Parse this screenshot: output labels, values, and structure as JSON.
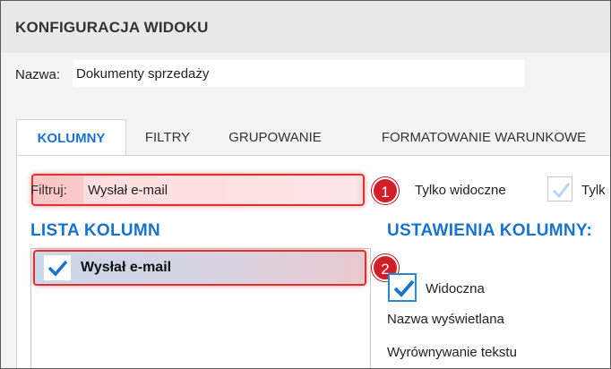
{
  "window": {
    "title": "KONFIGURACJA WIDOKU"
  },
  "name_field": {
    "label": "Nazwa:",
    "value": "Dokumenty sprzedaży"
  },
  "tabs": [
    {
      "label": "KOLUMNY",
      "active": true
    },
    {
      "label": "FILTRY",
      "active": false
    },
    {
      "label": "GRUPOWANIE",
      "active": false
    },
    {
      "label": "FORMATOWANIE WARUNKOWE",
      "active": false
    }
  ],
  "filter": {
    "label": "Filtruj:",
    "value": "Wysłał e-mail"
  },
  "options": {
    "only_visible_label": "Tylko widoczne",
    "truncated_label": "Tylk"
  },
  "callouts": {
    "one": "1",
    "two": "2"
  },
  "columns_list": {
    "header": "LISTA KOLUMN",
    "items": [
      {
        "label": "Wysłał e-mail",
        "checked": true,
        "selected": true
      }
    ]
  },
  "column_settings": {
    "header": "USTAWIENIA KOLUMNY:",
    "visible_label": "Widoczna",
    "visible_checked": true,
    "display_name_label": "Nazwa wyświetlana",
    "text_align_label": "Wyrównywanie tekstu"
  },
  "colors": {
    "accent": "#1b73c7",
    "highlight_border": "#e03030",
    "badge": "#d11f2a",
    "title_bar": "#e9e9e9"
  }
}
